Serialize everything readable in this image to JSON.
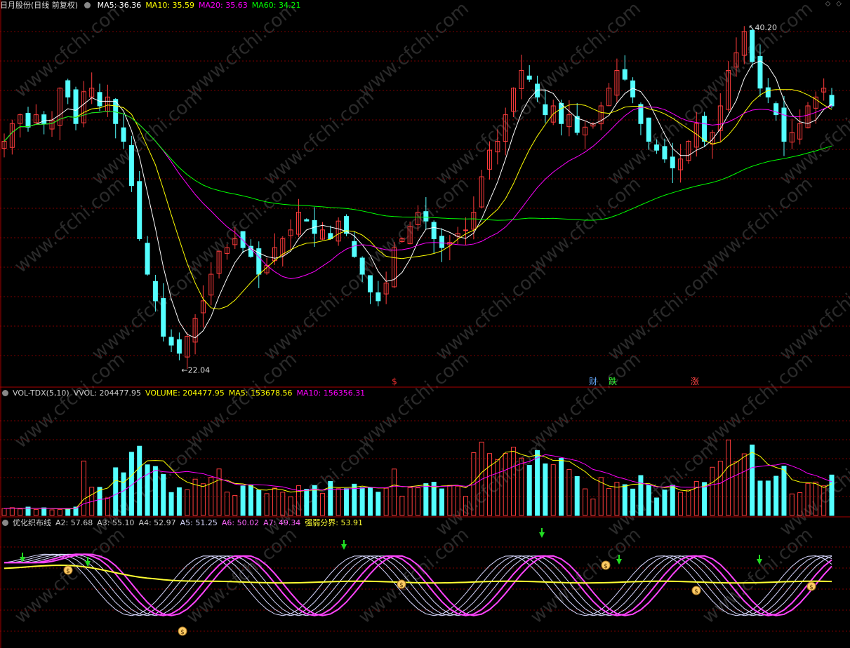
{
  "colors": {
    "bg": "#000000",
    "up": "#ff3c3c",
    "down": "#54ffff",
    "ma5": "#ffffff",
    "ma10": "#ffff00",
    "ma20": "#ff00ff",
    "ma60": "#00ff00",
    "grid": "#7a0000",
    "vol_ma5": "#ffff00",
    "vol_ma10": "#ff00ff",
    "a_line": "#d8d8ff",
    "a_edge": "#ff44ff",
    "divide": "#ffff33",
    "signal_down": "#22dd22",
    "signal_bag": "#ffcc66"
  },
  "main_panel": {
    "title": "日月股份(日线 前复权)",
    "indicators": [
      {
        "label": "MA5: 36.36",
        "color": "#ffffff"
      },
      {
        "label": "MA10: 35.59",
        "color": "#ffff00"
      },
      {
        "label": "MA20: 35.63",
        "color": "#ff00ff"
      },
      {
        "label": "MA60: 34.21",
        "color": "#00ff00"
      }
    ],
    "high_label": "40.20",
    "low_label": "22.04",
    "markers": [
      {
        "text": "$",
        "color": "#ff3333"
      },
      {
        "text": "财",
        "color": "#66aaff"
      },
      {
        "text": "跌",
        "color": "#33ff33"
      },
      {
        "text": "涨",
        "color": "#ff4444"
      }
    ]
  },
  "volume_panel": {
    "indicators": [
      {
        "label": "VOL-TDX(5,10)",
        "color": "#cccccc"
      },
      {
        "label": "VVOL: 204477.95",
        "color": "#cccccc"
      },
      {
        "label": "VOLUME: 204477.95",
        "color": "#ffff00"
      },
      {
        "label": "MA5: 153678.56",
        "color": "#ffff00"
      },
      {
        "label": "MA10: 156356.31",
        "color": "#ff00ff"
      }
    ]
  },
  "ind_panel": {
    "indicators": [
      {
        "label": "优化织布线",
        "color": "#cccccc"
      },
      {
        "label": "A2: 57.68",
        "color": "#cccccc"
      },
      {
        "label": "A3: 55.10",
        "color": "#cccccc"
      },
      {
        "label": "A4: 52.97",
        "color": "#cccccc"
      },
      {
        "label": "A5: 51.25",
        "color": "#d8d8ff"
      },
      {
        "label": "A6: 50.02",
        "color": "#ff66ff"
      },
      {
        "label": "A7: 49.34",
        "color": "#ff66ff"
      },
      {
        "label": "强弱分界: 53.91",
        "color": "#ffff33"
      }
    ]
  },
  "watermark": "www.cfchi.com",
  "chart_data": [
    {
      "type": "candlestick",
      "name": "日月股份(日线 前复权)",
      "close_path": [
        34.0,
        35.0,
        35.5,
        34.8,
        35.5,
        35.0,
        35.2,
        37.0,
        36.5,
        35.0,
        36.8,
        37.0,
        36.0,
        36.5,
        35.0,
        34.0,
        31.5,
        28.5,
        26.5,
        25.0,
        23.0,
        22.5,
        22.04,
        23.0,
        24.0,
        25.0,
        26.5,
        27.8,
        28.0,
        28.5,
        28.0,
        27.5,
        26.5,
        27.0,
        28.0,
        28.5,
        29.0,
        30.0,
        29.5,
        28.8,
        29.0,
        28.5,
        29.5,
        28.8,
        27.5,
        26.5,
        25.5,
        25.0,
        26.0,
        28.0,
        28.5,
        29.2,
        30.0,
        29.5,
        28.5,
        28.0,
        28.3,
        28.8,
        29.0,
        30.0,
        32.0,
        33.5,
        34.0,
        35.5,
        37.0,
        38.0,
        37.5,
        36.5,
        35.5,
        36.0,
        35.0,
        35.5,
        34.5,
        34.8,
        35.0,
        36.0,
        37.0,
        38.0,
        37.5,
        36.5,
        35.0,
        34.0,
        33.5,
        33.0,
        32.5,
        33.0,
        34.0,
        35.0,
        34.0,
        34.5,
        36.0,
        38.0,
        39.0,
        40.2,
        38.5,
        37.0,
        36.5,
        35.5,
        34.0,
        34.5,
        35.0,
        36.0,
        36.5,
        37.0,
        36.0
      ],
      "high": 40.2,
      "low": 22.04,
      "ma": {
        "MA5": 36.36,
        "MA10": 35.59,
        "MA20": 35.63,
        "MA60": 34.21
      }
    },
    {
      "type": "bar",
      "name": "VOL-TDX(5,10)",
      "values": {
        "VOLUME": 204477.95,
        "MA5": 153678.56,
        "MA10": 156356.31
      }
    },
    {
      "type": "line",
      "name": "优化织布线",
      "values": {
        "A2": 57.68,
        "A3": 55.1,
        "A4": 52.97,
        "A5": 51.25,
        "A6": 50.02,
        "A7": 49.34,
        "强弱分界": 53.91
      }
    }
  ]
}
